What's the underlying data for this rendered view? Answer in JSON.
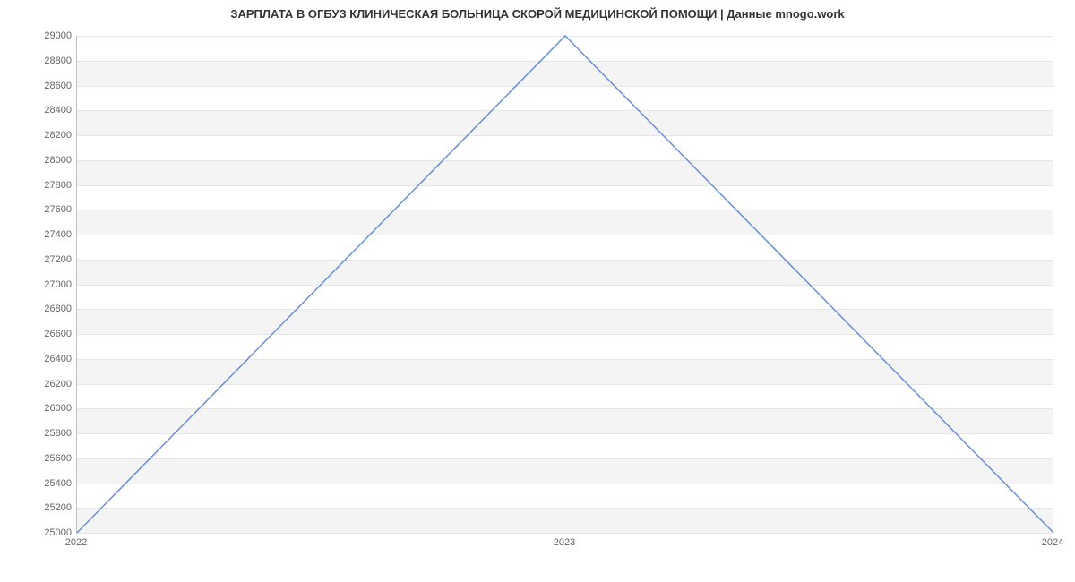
{
  "chart_data": {
    "type": "line",
    "title": "ЗАРПЛАТА В ОГБУЗ КЛИНИЧЕСКАЯ БОЛЬНИЦА СКОРОЙ МЕДИЦИНСКОЙ ПОМОЩИ | Данные mnogo.work",
    "x": [
      2022,
      2023,
      2024
    ],
    "values": [
      25000,
      29000,
      25000
    ],
    "xlabel": "",
    "ylabel": "",
    "x_ticks": [
      2022,
      2023,
      2024
    ],
    "y_ticks": [
      25000,
      25200,
      25400,
      25600,
      25800,
      26000,
      26200,
      26400,
      26600,
      26800,
      27000,
      27200,
      27400,
      27600,
      27800,
      28000,
      28200,
      28400,
      28600,
      28800,
      29000
    ],
    "xlim": [
      2022,
      2024
    ],
    "ylim": [
      25000,
      29000
    ],
    "line_color": "#6a8fd4",
    "grid": true
  }
}
